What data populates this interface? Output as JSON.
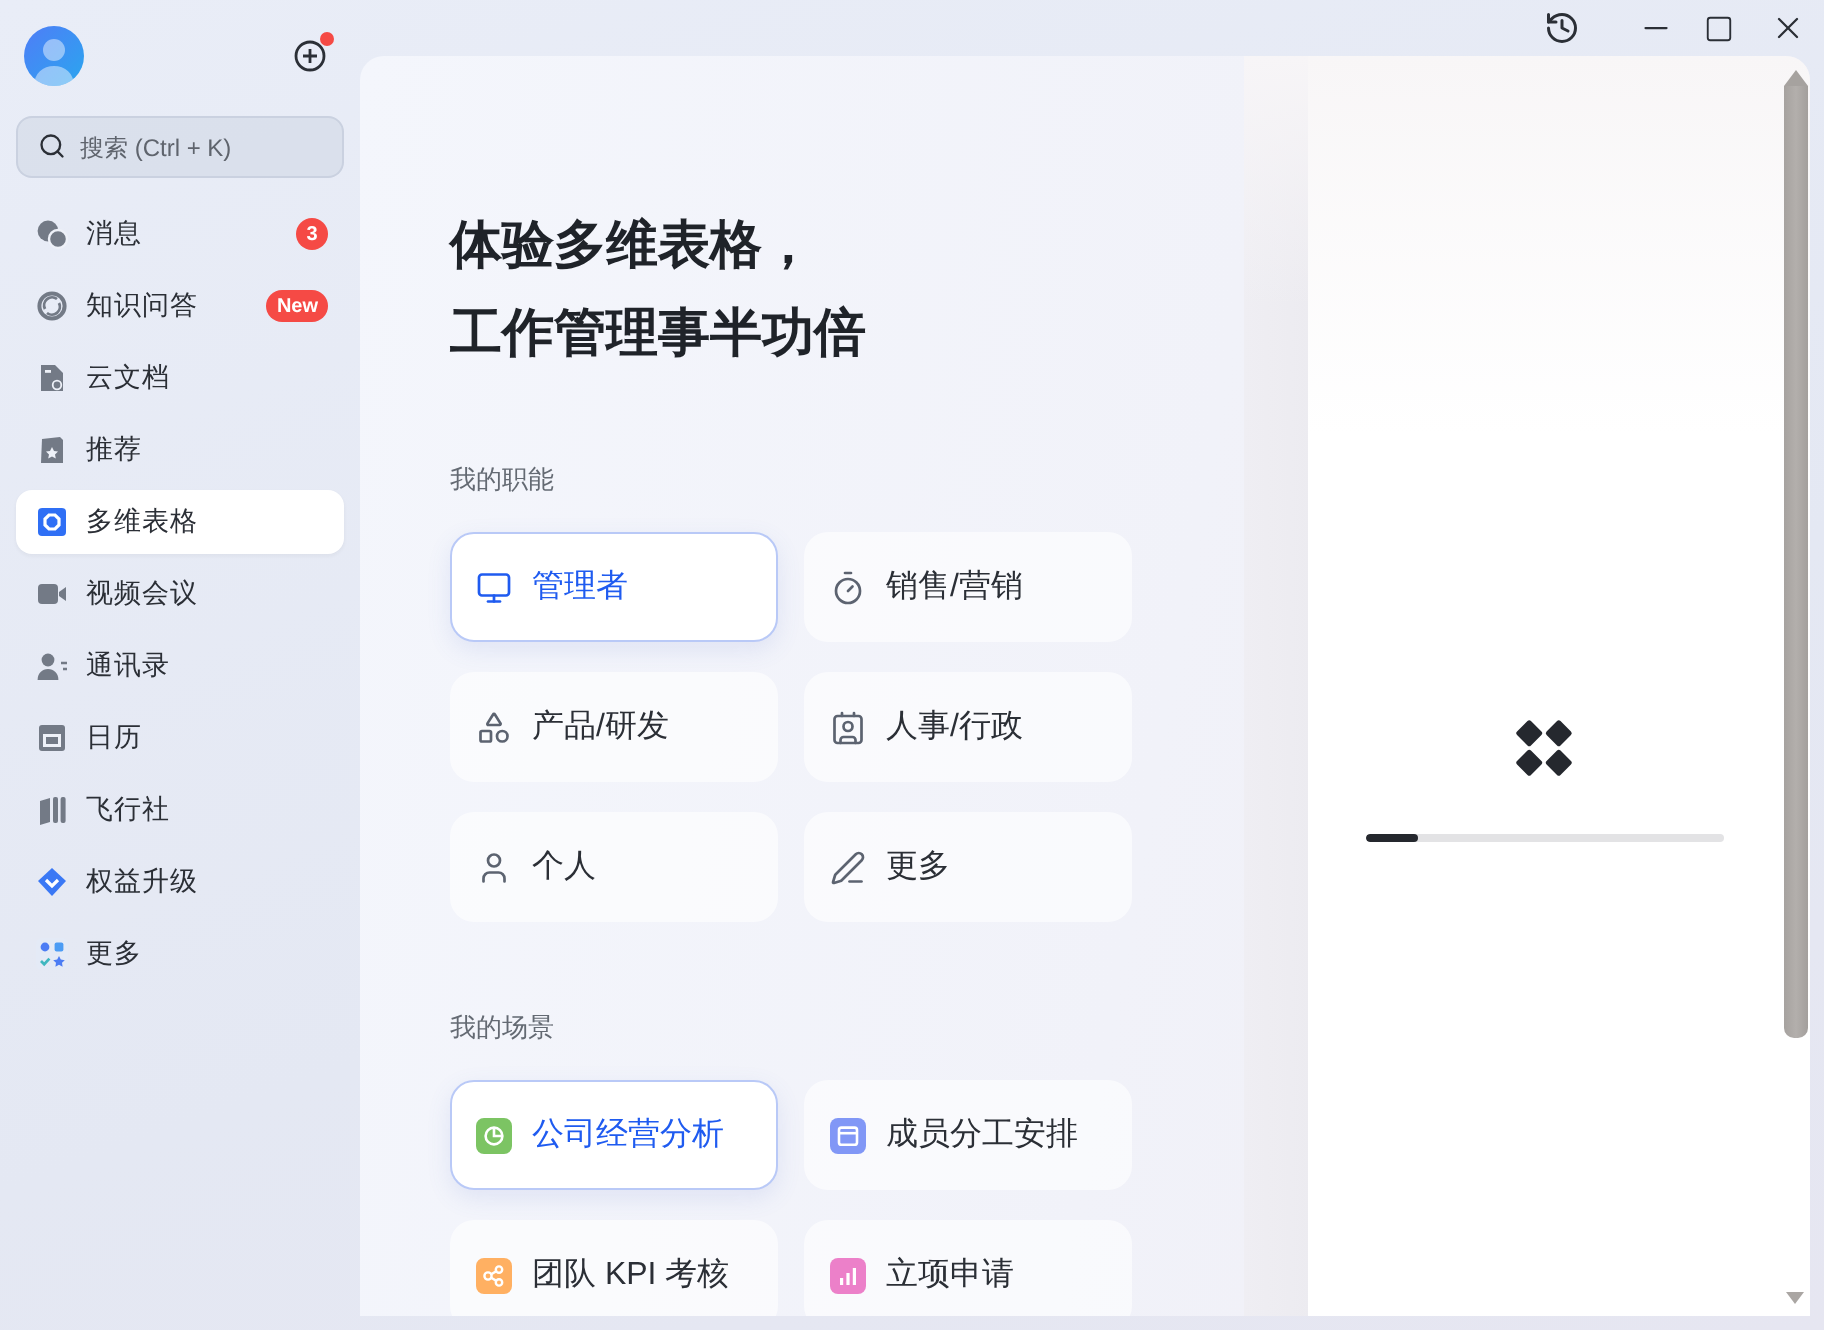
{
  "sidebar": {
    "add_button": {
      "has_notification": true
    },
    "search": {
      "placeholder": "搜索 (Ctrl + K)"
    },
    "items": [
      {
        "label": "消息",
        "selected": false,
        "badge": {
          "kind": "count",
          "text": "3"
        }
      },
      {
        "label": "知识问答",
        "selected": false,
        "badge": {
          "kind": "tag",
          "text": "New"
        }
      },
      {
        "label": "云文档",
        "selected": false
      },
      {
        "label": "推荐",
        "selected": false
      },
      {
        "label": "多维表格",
        "selected": true
      },
      {
        "label": "视频会议",
        "selected": false
      },
      {
        "label": "通讯录",
        "selected": false
      },
      {
        "label": "日历",
        "selected": false
      },
      {
        "label": "飞行社",
        "selected": false
      },
      {
        "label": "权益升级",
        "selected": false
      },
      {
        "label": "更多",
        "selected": false
      }
    ]
  },
  "hero": {
    "title_lines": [
      "体验多维表格，",
      "工作管理事半功倍"
    ]
  },
  "roles": {
    "heading": "我的职能",
    "items": [
      {
        "label": "管理者",
        "selected": true
      },
      {
        "label": "销售/营销",
        "selected": false
      },
      {
        "label": "产品/研发",
        "selected": false
      },
      {
        "label": "人事/行政",
        "selected": false
      },
      {
        "label": "个人",
        "selected": false
      },
      {
        "label": "更多",
        "selected": false
      }
    ]
  },
  "scenes": {
    "heading": "我的场景",
    "items": [
      {
        "label": "公司经营分析",
        "selected": true,
        "color": "#7cc463"
      },
      {
        "label": "成员分工安排",
        "selected": false,
        "color": "#8197f6"
      },
      {
        "label": "团队 KPI 考核",
        "selected": false,
        "color": "#ffb062"
      },
      {
        "label": "立项申请",
        "selected": false,
        "color": "#ec80c9"
      }
    ]
  },
  "preview": {
    "loader": {
      "level": 0.15
    }
  }
}
